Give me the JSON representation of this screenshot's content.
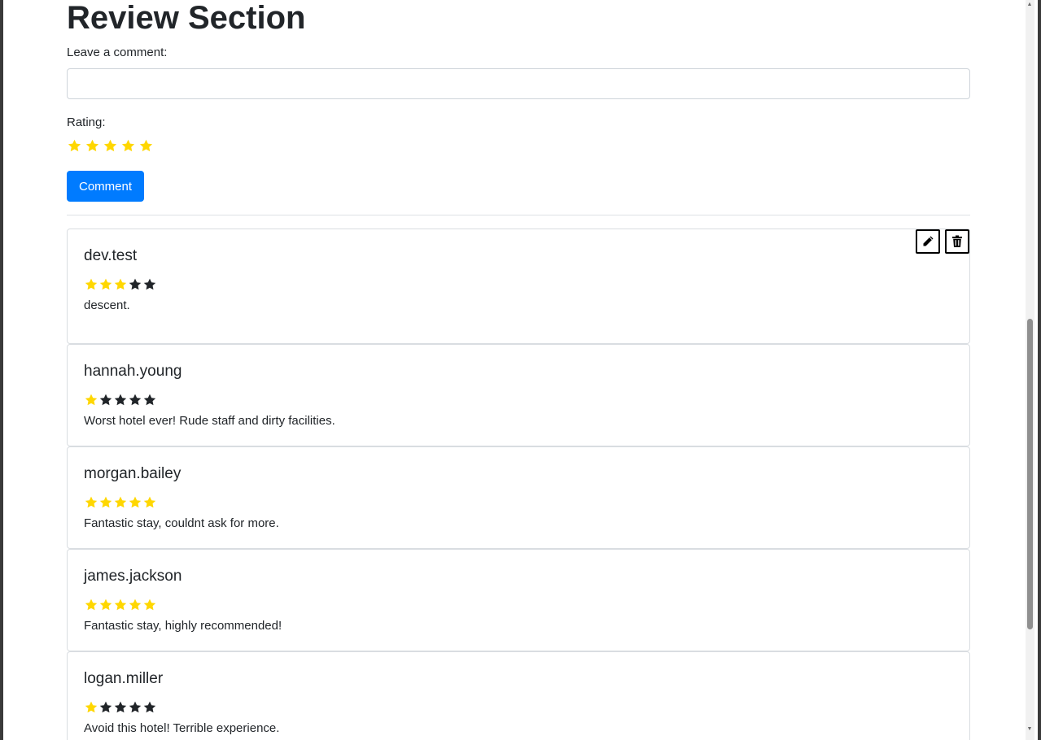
{
  "page": {
    "title": "Review Section"
  },
  "form": {
    "comment_label": "Leave a comment:",
    "comment_value": "",
    "comment_placeholder": "",
    "rating_label": "Rating:",
    "rating_value": 5,
    "rating_max": 5,
    "submit_label": "Comment"
  },
  "colors": {
    "star_filled": "#ffd700",
    "star_empty": "#212529",
    "primary": "#007bff"
  },
  "reviews": [
    {
      "user": "dev.test",
      "rating": 3,
      "text": "descent.",
      "own": true
    },
    {
      "user": "hannah.young",
      "rating": 1,
      "text": "Worst hotel ever! Rude staff and dirty facilities.",
      "own": false
    },
    {
      "user": "morgan.bailey",
      "rating": 5,
      "text": "Fantastic stay, couldnt ask for more.",
      "own": false
    },
    {
      "user": "james.jackson",
      "rating": 5,
      "text": "Fantastic stay, highly recommended!",
      "own": false
    },
    {
      "user": "logan.miller",
      "rating": 1,
      "text": "Avoid this hotel! Terrible experience.",
      "own": false
    }
  ],
  "icons": {
    "edit": "pencil-icon",
    "delete": "trash-icon"
  }
}
